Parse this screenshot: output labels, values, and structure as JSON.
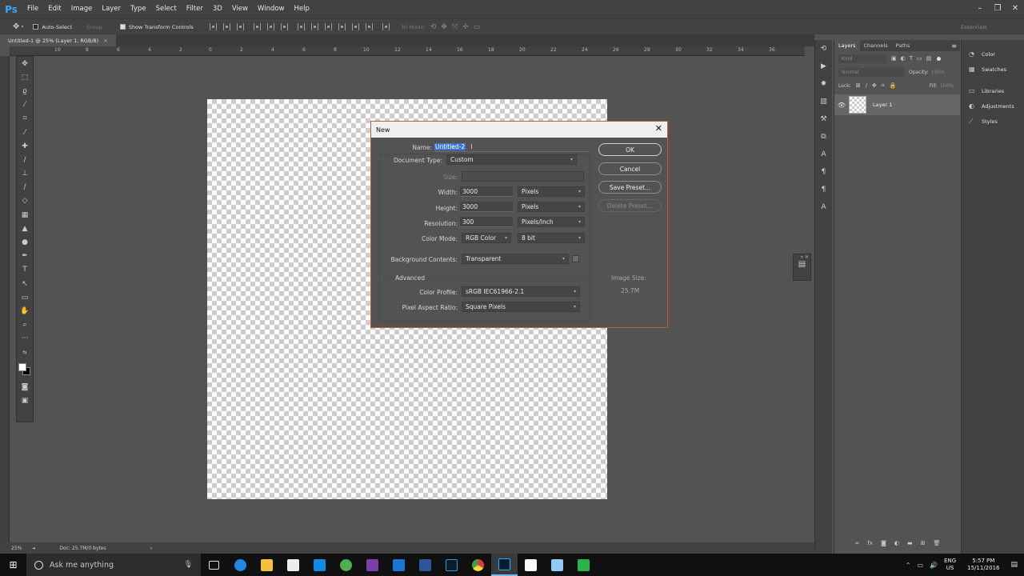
{
  "app": {
    "logo": "Ps"
  },
  "menu": [
    "File",
    "Edit",
    "Image",
    "Layer",
    "Type",
    "Select",
    "Filter",
    "3D",
    "View",
    "Window",
    "Help"
  ],
  "options": {
    "auto_select": "Auto-Select",
    "group": "Group",
    "show_transform": "Show Transform Controls",
    "mode_3d": "3D Mode:",
    "workspace": "Essentials"
  },
  "doc_tab": {
    "title": "Untitled-1 @ 25% (Layer 1, RGB/8)",
    "close": "×"
  },
  "ruler_ticks": [
    "10",
    "8",
    "6",
    "4",
    "2",
    "0",
    "2",
    "4",
    "6",
    "8",
    "10",
    "12",
    "14",
    "16",
    "18",
    "20",
    "22",
    "24",
    "26",
    "28",
    "30",
    "32",
    "34",
    "36"
  ],
  "status": {
    "zoom": "25%",
    "doc": "Doc: 25.7M/0 bytes"
  },
  "dialog": {
    "title": "New",
    "name_label": "Name:",
    "name_value": "Untitled-2",
    "doctype_label": "Document Type:",
    "doctype_value": "Custom",
    "size_label": "Size:",
    "width_label": "Width:",
    "width_value": "3000",
    "width_unit": "Pixels",
    "height_label": "Height:",
    "height_value": "3000",
    "height_unit": "Pixels",
    "res_label": "Resolution:",
    "res_value": "300",
    "res_unit": "Pixels/Inch",
    "mode_label": "Color Mode:",
    "mode_value": "RGB Color",
    "mode_depth": "8 bit",
    "bg_label": "Background Contents:",
    "bg_value": "Transparent",
    "advanced": "Advanced",
    "profile_label": "Color Profile:",
    "profile_value": "sRGB IEC61966-2.1",
    "aspect_label": "Pixel Aspect Ratio:",
    "aspect_value": "Square Pixels",
    "ok": "OK",
    "cancel": "Cancel",
    "save_preset": "Save Preset...",
    "delete_preset": "Delete Preset...",
    "image_size_label": "Image Size:",
    "image_size_value": "25.7M"
  },
  "layers_panel": {
    "tabs": [
      "Layers",
      "Channels",
      "Paths"
    ],
    "kind": "Kind",
    "blend": "Normal",
    "opacity_label": "Opacity:",
    "opacity_value": "100%",
    "lock_label": "Lock:",
    "fill_label": "Fill:",
    "fill_value": "100%",
    "layer_name": "Layer 1"
  },
  "side_panel": {
    "items": [
      "Color",
      "Swatches",
      "Libraries",
      "Adjustments",
      "Styles"
    ]
  },
  "taskbar": {
    "search": "Ask me anything",
    "lang": "ENG",
    "region": "US",
    "time": "5:57 PM",
    "date": "15/11/2016"
  }
}
